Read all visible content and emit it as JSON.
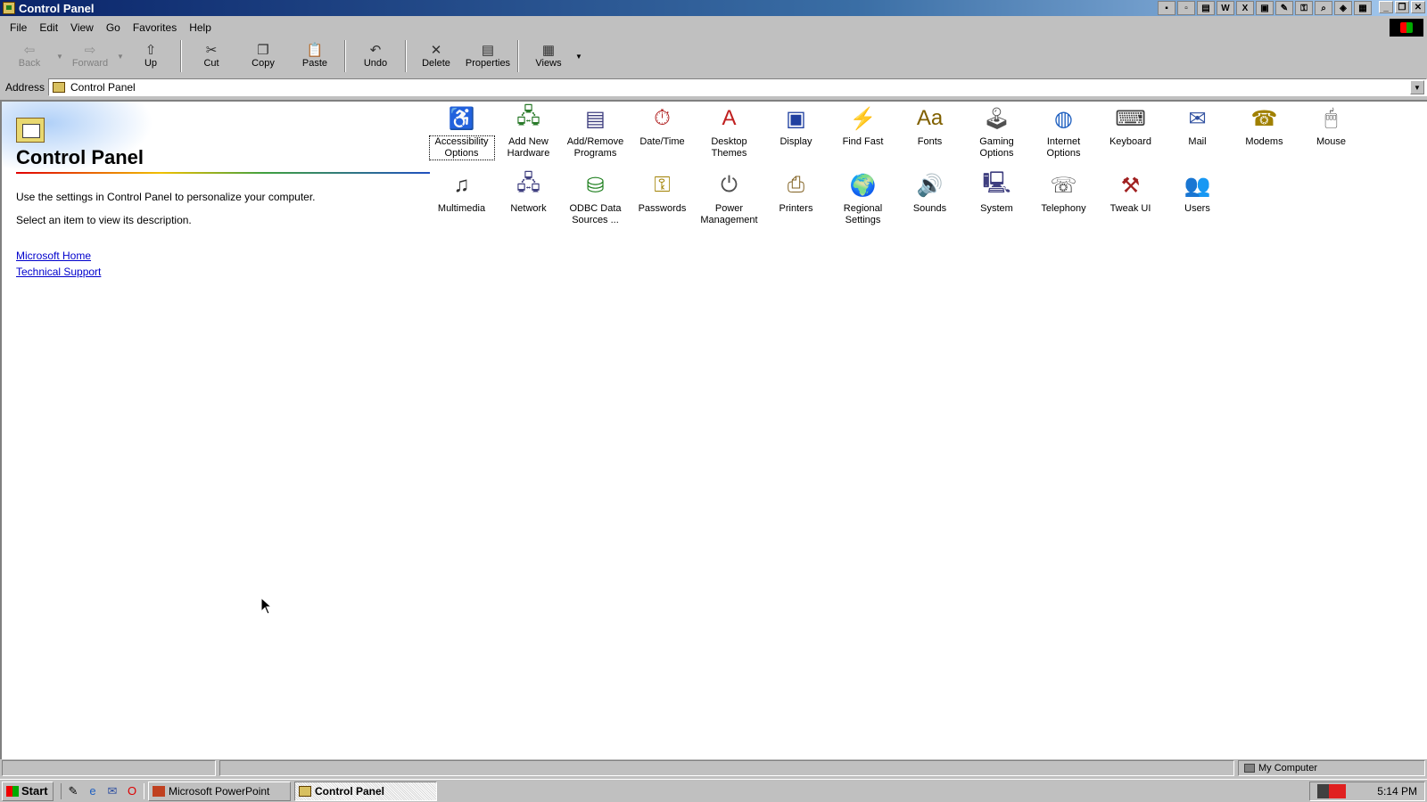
{
  "window": {
    "title": "Control Panel"
  },
  "menu": [
    "File",
    "Edit",
    "View",
    "Go",
    "Favorites",
    "Help"
  ],
  "toolbar": {
    "back": "Back",
    "forward": "Forward",
    "up": "Up",
    "cut": "Cut",
    "copy": "Copy",
    "paste": "Paste",
    "undo": "Undo",
    "delete": "Delete",
    "properties": "Properties",
    "views": "Views"
  },
  "address": {
    "label": "Address",
    "value": "Control Panel"
  },
  "info": {
    "title": "Control Panel",
    "line1": "Use the settings in Control Panel to personalize your computer.",
    "line2": "Select an item to view its description.",
    "link1": "Microsoft Home",
    "link2": "Technical Support"
  },
  "items": [
    {
      "label": "Accessibility Options",
      "icon": "♿",
      "color": "#1a3aa0"
    },
    {
      "label": "Add New Hardware",
      "icon": "🖧",
      "color": "#2a7a2a"
    },
    {
      "label": "Add/Remove Programs",
      "icon": "▤",
      "color": "#404080"
    },
    {
      "label": "Date/Time",
      "icon": "⏱",
      "color": "#b02020"
    },
    {
      "label": "Desktop Themes",
      "icon": "A",
      "color": "#c02020"
    },
    {
      "label": "Display",
      "icon": "▣",
      "color": "#2040a0"
    },
    {
      "label": "Find Fast",
      "icon": "⚡",
      "color": "#303030"
    },
    {
      "label": "Fonts",
      "icon": "Aa",
      "color": "#806000"
    },
    {
      "label": "Gaming Options",
      "icon": "🕹",
      "color": "#505050"
    },
    {
      "label": "Internet Options",
      "icon": "◍",
      "color": "#2060c0"
    },
    {
      "label": "Keyboard",
      "icon": "⌨",
      "color": "#404040"
    },
    {
      "label": "Mail",
      "icon": "✉",
      "color": "#3050a0"
    },
    {
      "label": "Modems",
      "icon": "☎",
      "color": "#a08000"
    },
    {
      "label": "Mouse",
      "icon": "🖱",
      "color": "#505050"
    },
    {
      "label": "Multimedia",
      "icon": "♫",
      "color": "#303030"
    },
    {
      "label": "Network",
      "icon": "🖧",
      "color": "#404080"
    },
    {
      "label": "ODBC Data Sources ...",
      "icon": "⛁",
      "color": "#208020"
    },
    {
      "label": "Passwords",
      "icon": "⚿",
      "color": "#a08000"
    },
    {
      "label": "Power Management",
      "icon": "⏻",
      "color": "#505050"
    },
    {
      "label": "Printers",
      "icon": "⎙",
      "color": "#806020"
    },
    {
      "label": "Regional Settings",
      "icon": "🌍",
      "color": "#207020"
    },
    {
      "label": "Sounds",
      "icon": "🔊",
      "color": "#2040a0"
    },
    {
      "label": "System",
      "icon": "🖳",
      "color": "#404080"
    },
    {
      "label": "Telephony",
      "icon": "☏",
      "color": "#404040"
    },
    {
      "label": "Tweak UI",
      "icon": "⚒",
      "color": "#a02020"
    },
    {
      "label": "Users",
      "icon": "👥",
      "color": "#303030"
    }
  ],
  "status": {
    "zone": "My Computer"
  },
  "taskbar": {
    "start": "Start",
    "tasks": [
      "Microsoft PowerPoint",
      "Control Panel"
    ],
    "clock": "5:14 PM"
  }
}
